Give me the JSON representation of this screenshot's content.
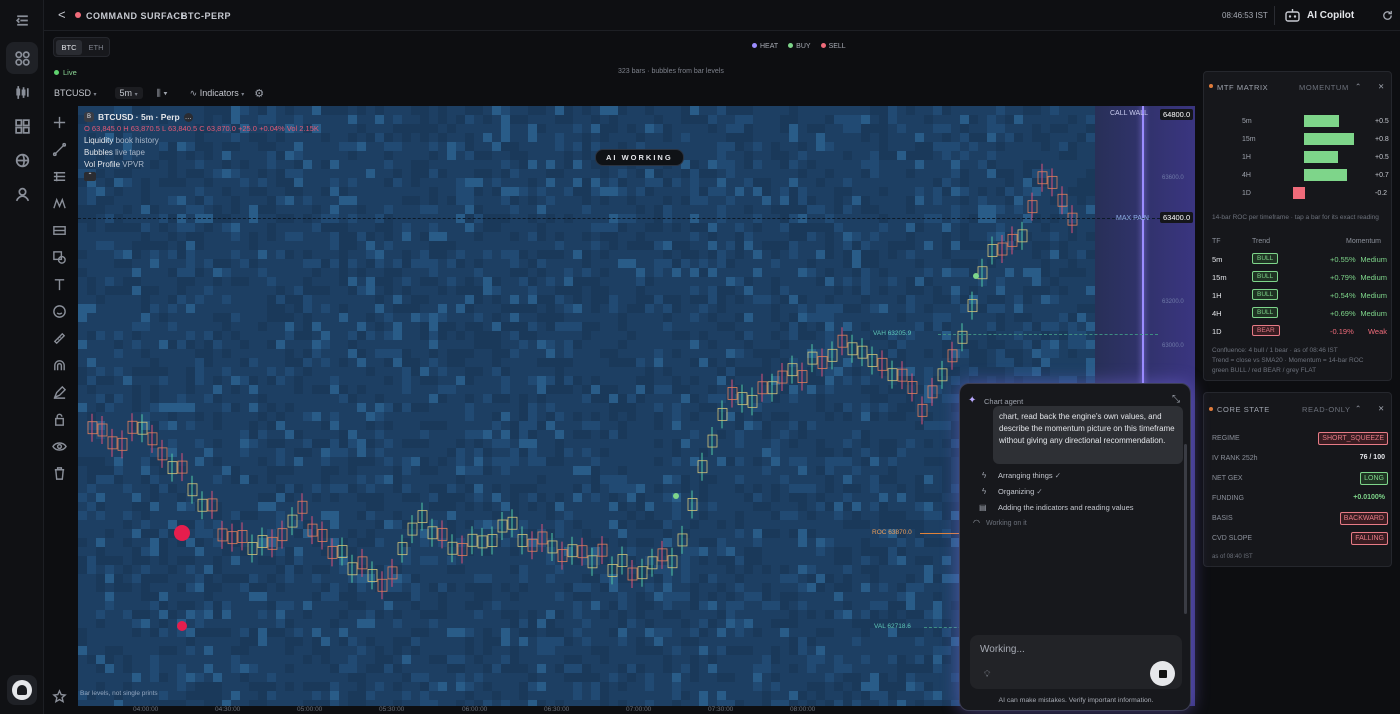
{
  "header": {
    "back": "<",
    "title": "COMMAND SURFACE",
    "sep": "·",
    "symbol": "BTC-PERP",
    "clock": "08:46:53 IST",
    "copilot": "AI Copilot"
  },
  "asset_tabs": [
    "BTC",
    "ETH"
  ],
  "legend": [
    "HEAT",
    "BUY",
    "SELL"
  ],
  "legend_colors": [
    "#9b8cff",
    "#7ed58a",
    "#ef6b7a"
  ],
  "live": "Live",
  "bars_info": "323 bars · bubbles from bar levels",
  "toolbar": {
    "symbol": "BTCUSD",
    "interval": "5m",
    "indicators": "Indicators"
  },
  "chart": {
    "title": "BTCUSD · 5m · Perp",
    "ohlc": "O 63,845.0 H 63,870.5 L 63,840.5 C 63,870.0 +25.0 +0.04% Vol 2.15K",
    "liq": "Liquidity",
    "liq_sub": "book history",
    "bub": "Bubbles",
    "bub_sub": "live tape",
    "vp": "Vol Profile",
    "vp_sub": "VPVR",
    "ai_working": "AI WORKING",
    "call_wall": "CALL WALL",
    "call_wall_price": "64800.0",
    "max_pain": "MAX PAIN",
    "max_pain_price": "63400.0",
    "vah": "VAH 63205.9",
    "roc": "ROC 63870.0",
    "val": "VAL 62718.6",
    "footnote": "Bar levels, not single prints",
    "price_ticks": [
      "63600.0",
      "63200.0",
      "63000.0",
      "62800.0"
    ],
    "time_ticks": [
      "04:00:00",
      "04:30:00",
      "05:00:00",
      "05:30:00",
      "06:00:00",
      "06:30:00",
      "07:00:00",
      "07:30:00",
      "08:00:00"
    ]
  },
  "mtf": {
    "title": "MTF MATRIX",
    "mode": "MOMENTUM",
    "bars": [
      {
        "tf": "5m",
        "v": "+0.5",
        "f": 0.55
      },
      {
        "tf": "15m",
        "v": "+0.8",
        "f": 0.79
      },
      {
        "tf": "1H",
        "v": "+0.5",
        "f": 0.54
      },
      {
        "tf": "4H",
        "v": "+0.7",
        "f": 0.69
      },
      {
        "tf": "1D",
        "v": "-0.2",
        "f": 0.19
      }
    ],
    "hint": "14-bar ROC per timeframe · tap a bar for its exact reading",
    "cols": [
      "TF",
      "Trend",
      "Momentum"
    ],
    "rows": [
      {
        "tf": "5m",
        "trend": "BULL",
        "mom": "+0.55%",
        "str": "Medium"
      },
      {
        "tf": "15m",
        "trend": "BULL",
        "mom": "+0.79%",
        "str": "Medium"
      },
      {
        "tf": "1H",
        "trend": "BULL",
        "mom": "+0.54%",
        "str": "Medium"
      },
      {
        "tf": "4H",
        "trend": "BULL",
        "mom": "+0.69%",
        "str": "Medium"
      },
      {
        "tf": "1D",
        "trend": "BEAR",
        "mom": "-0.19%",
        "str": "Weak"
      }
    ],
    "foot1": "Confluence: 4 bull / 1 bear · as of 08:46 IST",
    "foot2": "Trend = close vs SMA20 · Momentum = 14-bar ROC",
    "foot3": "green BULL / red BEAR / grey FLAT"
  },
  "core": {
    "title": "CORE STATE",
    "mode": "READ-ONLY",
    "rows": [
      {
        "k": "REGIME",
        "v": "SHORT_SQUEEZE",
        "c": "bear"
      },
      {
        "k": "IV RANK 252h",
        "v": "76 / 100",
        "c": "plain"
      },
      {
        "k": "NET GEX",
        "v": "LONG",
        "c": "bull"
      },
      {
        "k": "FUNDING",
        "v": "+0.0100%",
        "c": "greentext"
      },
      {
        "k": "BASIS",
        "v": "BACKWARD",
        "c": "bear"
      },
      {
        "k": "CVD SLOPE",
        "v": "FALLING",
        "c": "bear"
      }
    ],
    "asof": "as of 08:40 IST"
  },
  "agent": {
    "title": "Chart agent",
    "msg": "chart, read back the engine's own values, and describe the momentum picture on this timeframe without giving any directional recommendation.",
    "steps": [
      "Arranging things",
      "Organizing",
      "Adding the indicators and reading values"
    ],
    "working": "Working on it",
    "input_placeholder": "Working...",
    "disclaimer": "AI can make mistakes. Verify important information."
  }
}
